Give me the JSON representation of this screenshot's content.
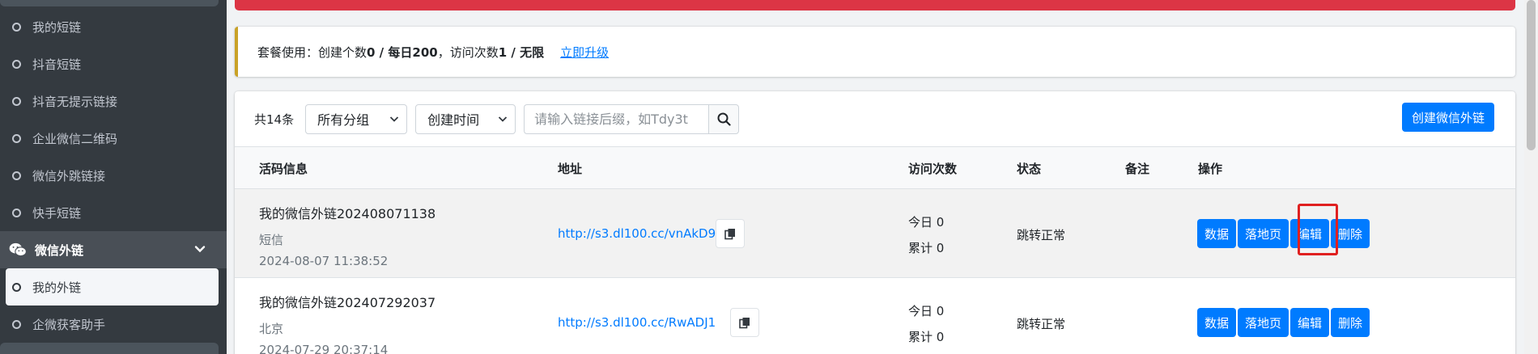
{
  "sidebar": {
    "items": [
      {
        "label": "我的短链"
      },
      {
        "label": "抖音短链"
      },
      {
        "label": "抖音无提示链接"
      },
      {
        "label": "企业微信二维码"
      },
      {
        "label": "微信外跳链接"
      },
      {
        "label": "快手短链"
      }
    ],
    "group": {
      "label": "微信外链",
      "icon": "wechat-icon"
    },
    "sub_items": [
      {
        "label": "我的外链",
        "active": true
      },
      {
        "label": "企微获客助手"
      }
    ]
  },
  "plan": {
    "prefix": "套餐使用：创建个数",
    "create_usage": "0 / 每日200",
    "mid": "，访问次数",
    "visit_usage": "1 / 无限",
    "upgrade_link": "立即升级"
  },
  "toolbar": {
    "total": "共14条",
    "group_select": "所有分组",
    "time_select": "创建时间",
    "search_placeholder": "请输入链接后缀，如Tdy3t",
    "create_button": "创建微信外链"
  },
  "table": {
    "headers": {
      "info": "活码信息",
      "url": "地址",
      "visits": "访问次数",
      "status": "状态",
      "note": "备注",
      "ops": "操作"
    },
    "rows": [
      {
        "name": "我的微信外链202408071138",
        "group": "短信",
        "created": "2024-08-07 11:38:52",
        "url": "http://s3.dl100.cc/vnAkD9",
        "today": "今日 0",
        "total": "累计 0",
        "status": "跳转正常"
      },
      {
        "name": "我的微信外链202407292037",
        "group": "北京",
        "created": "2024-07-29 20:37:14",
        "url": "http://s3.dl100.cc/RwADJ1",
        "today": "今日 0",
        "total": "累计 0",
        "status": "跳转正常"
      }
    ],
    "ops_labels": {
      "data": "数据",
      "landing": "落地页",
      "edit": "编辑",
      "delete": "删除"
    }
  },
  "colors": {
    "primary": "#007bff",
    "danger": "#dc3545",
    "sidebar": "#343a40",
    "highlight": "#e02020"
  }
}
